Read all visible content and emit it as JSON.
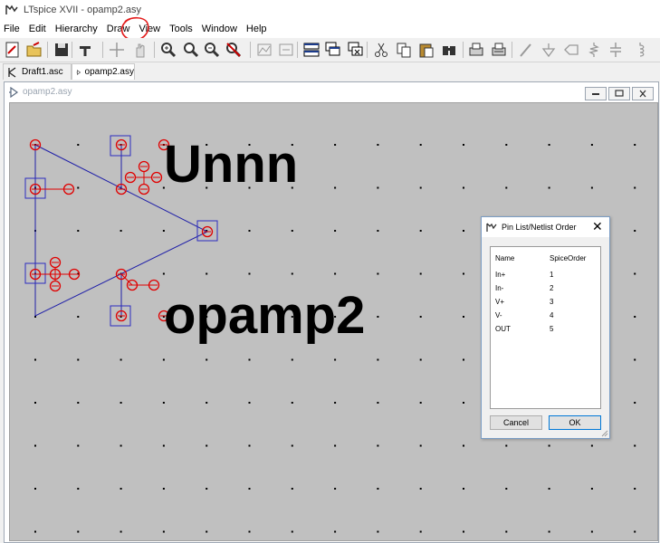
{
  "window": {
    "title": "LTspice XVII - opamp2.asy"
  },
  "menu": {
    "items": [
      {
        "id": "file",
        "label": "File"
      },
      {
        "id": "edit",
        "label": "Edit"
      },
      {
        "id": "hierarchy",
        "label": "Hierarchy"
      },
      {
        "id": "draw",
        "label": "Draw"
      },
      {
        "id": "view",
        "label": "View"
      },
      {
        "id": "tools",
        "label": "Tools"
      },
      {
        "id": "window",
        "label": "Window"
      },
      {
        "id": "help",
        "label": "Help"
      }
    ],
    "annotation_color": "#e31b1b"
  },
  "toolbar": {
    "icons": [
      "new-schematic-icon",
      "open-icon",
      "save-icon",
      "control-panel-icon",
      "move-icon",
      "drag-hand-icon",
      "zoom-in-icon",
      "zoom-pan-icon",
      "zoom-out-icon",
      "zoom-cancel-icon",
      "autorange-icon",
      "fit-to-window-icon",
      "tile-horizontal-icon",
      "cascade-icon",
      "close-all-icon",
      "cut-icon",
      "copy-icon",
      "paste-icon",
      "find-icon",
      "print-icon",
      "print-preview-icon",
      "draw-wire-icon",
      "ground-icon",
      "net-label-icon",
      "resistor-icon",
      "capacitor-icon",
      "inductor-icon"
    ]
  },
  "tabs": [
    {
      "label": "Draft1.asc",
      "icon": "schematic-icon",
      "active": false
    },
    {
      "label": "opamp2.asy",
      "icon": "symbol-icon",
      "active": true
    }
  ],
  "document": {
    "title": "opamp2.asy",
    "labels": {
      "top": "Unnn",
      "bottom": "opamp2"
    },
    "colors": {
      "canvas": "#c0c0c0",
      "wire": "#1f1fa8",
      "pin_box": "#2d2dc0",
      "pin_marker": "#e00000",
      "grid_dot": "#000000"
    }
  },
  "dialog": {
    "title": "Pin List/Netlist Order",
    "columns": {
      "name": "Name",
      "order": "SpiceOrder"
    },
    "pins": [
      {
        "name": "In+",
        "order": "1"
      },
      {
        "name": "In-",
        "order": "2"
      },
      {
        "name": "V+",
        "order": "3"
      },
      {
        "name": "V-",
        "order": "4"
      },
      {
        "name": "OUT",
        "order": "5"
      }
    ],
    "cancel_label": "Cancel",
    "ok_label": "OK"
  }
}
